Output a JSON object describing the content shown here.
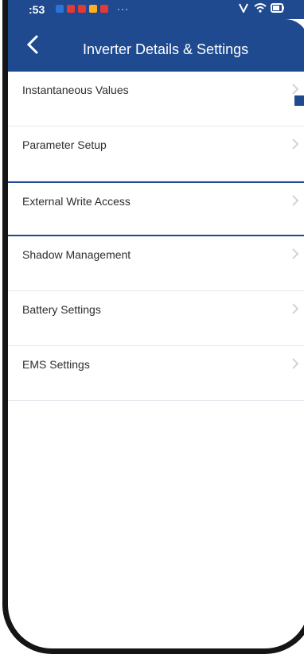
{
  "status_bar": {
    "time": ":53",
    "icons": [
      "notification-blue-icon",
      "notification-red-icon",
      "notification-red-icon",
      "notification-orange-icon",
      "notification-red-icon",
      "more-icon"
    ],
    "right_icons": [
      "nfc-icon",
      "wifi-icon",
      "battery-icon"
    ],
    "more_text": "···"
  },
  "header": {
    "title": "Inverter Details & Settings",
    "back_icon": "chevron-left-icon"
  },
  "menu": {
    "items": [
      {
        "label": "Instantaneous Values",
        "selected": false
      },
      {
        "label": "Parameter Setup",
        "selected": false
      },
      {
        "label": "External Write Access",
        "selected": true
      },
      {
        "label": "Shadow Management",
        "selected": false
      },
      {
        "label": "Battery Settings",
        "selected": false
      },
      {
        "label": "EMS Settings",
        "selected": false
      }
    ]
  },
  "colors": {
    "accent": "#1f4a8f",
    "background": "#ffffff",
    "text": "#2d2d2d",
    "chevron": "#d0d4db"
  }
}
